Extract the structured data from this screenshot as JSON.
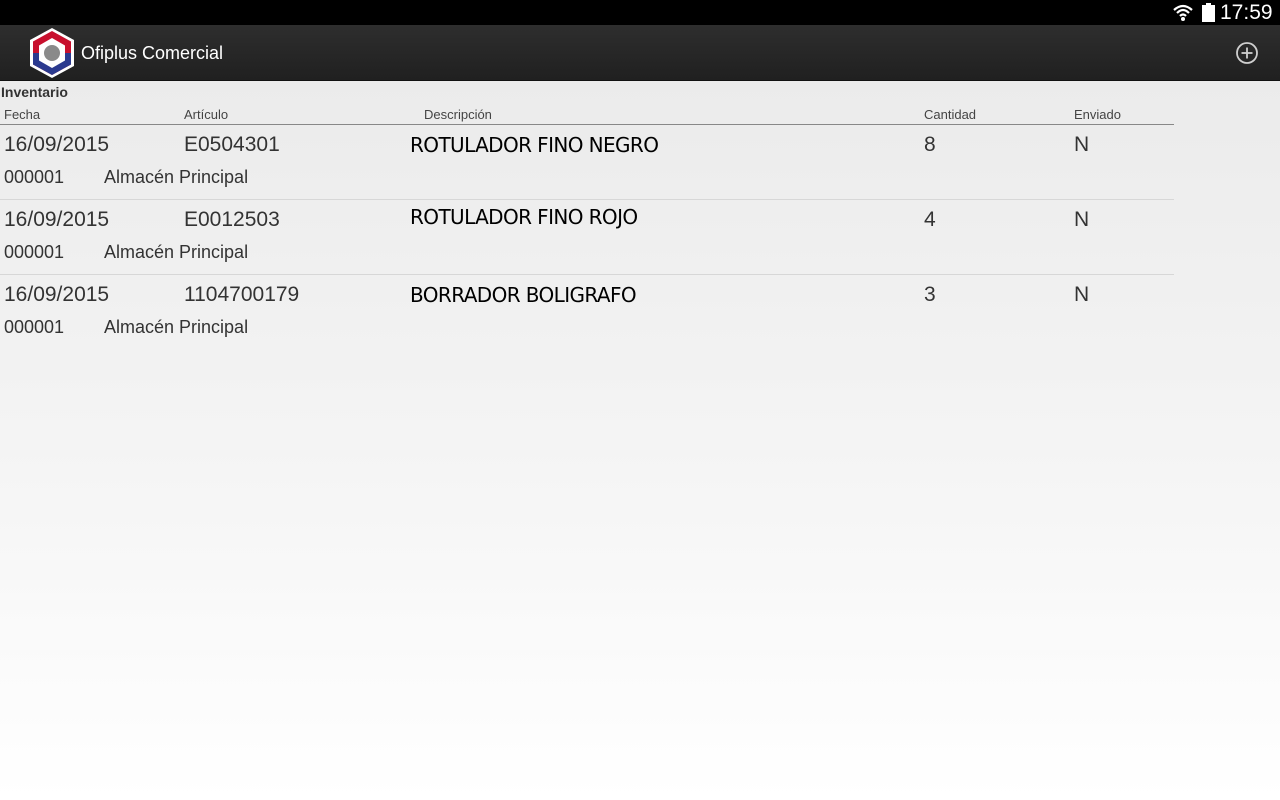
{
  "status_bar": {
    "time": "17:59",
    "wifi_icon": "wifi-icon",
    "battery_icon": "battery-icon"
  },
  "app_bar": {
    "title": "Ofiplus Comercial",
    "logo_icon": "ofiplus-hexagon-logo",
    "add_icon": "add-circle-icon",
    "colors": {
      "bar_background": "#262626",
      "logo_red": "#c8102e",
      "logo_blue": "#2b3a8f"
    }
  },
  "screen": {
    "title": "Inventario",
    "columns": [
      "Fecha",
      "Artículo",
      "Descripción",
      "Cantidad",
      "Enviado"
    ]
  },
  "items": [
    {
      "fecha": "16/09/2015",
      "articulo": "E0504301",
      "descripcion": "ROTULADOR FINO NEGRO",
      "cantidad": "8",
      "enviado": "N",
      "codigo": "000001",
      "almacen": "Almacén Principal"
    },
    {
      "fecha": "16/09/2015",
      "articulo": "E0012503",
      "descripcion": "ROTULADOR FINO ROJO",
      "cantidad": "4",
      "enviado": "N",
      "codigo": "000001",
      "almacen": "Almacén Principal"
    },
    {
      "fecha": "16/09/2015",
      "articulo": "1104700179",
      "descripcion": "BORRADOR BOLIGRAFO",
      "cantidad": "3",
      "enviado": "N",
      "codigo": "000001",
      "almacen": "Almacén Principal"
    }
  ]
}
